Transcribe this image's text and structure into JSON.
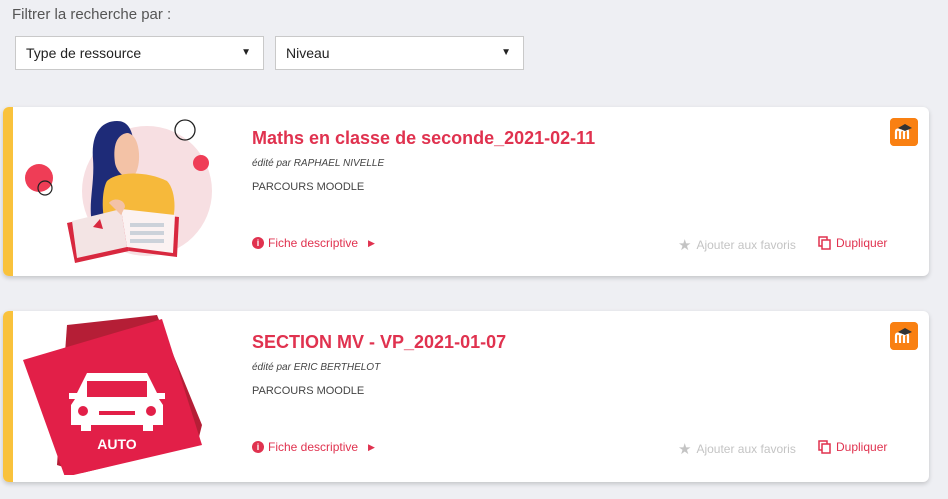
{
  "filters": {
    "label": "Filtrer la recherche par :",
    "type_select": "Type de ressource",
    "level_select": "Niveau"
  },
  "results": [
    {
      "title": "Maths en classe de seconde_2021-02-11",
      "author": "édité par RAPHAEL NIVELLE",
      "type": "PARCOURS MOODLE",
      "fiche_label": "Fiche descriptive",
      "favorite_label": "Ajouter aux favoris",
      "duplicate_label": "Dupliquer"
    },
    {
      "title": "SECTION MV - VP_2021-01-07",
      "author": "édité par ERIC BERTHELOT",
      "type": "PARCOURS MOODLE",
      "fiche_label": "Fiche descriptive",
      "favorite_label": "Ajouter aux favoris",
      "duplicate_label": "Dupliquer",
      "thumb_text": "AUTO"
    }
  ],
  "colors": {
    "accent": "#f9c23c",
    "brand_red": "#e0324f",
    "moodle_orange": "#f98012"
  }
}
